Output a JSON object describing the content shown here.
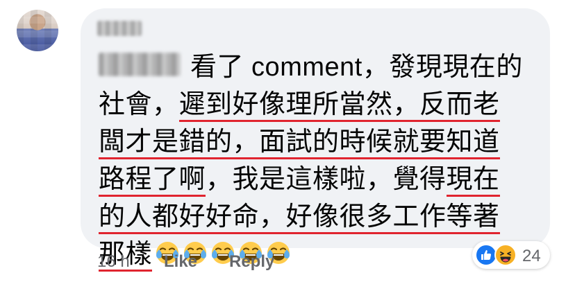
{
  "comment": {
    "lines": [
      "看了 comment，發現現在的",
      "社會，",
      "遲到好像理所當然，反而老",
      "闆才是錯的，面試的時候就要知道",
      "路程了啊",
      "，我是這樣啦，覺得",
      "現在",
      "的人都好好命，好像很多工作等著",
      "那樣"
    ],
    "emoji_name": "laughing-tears-emoji",
    "emoji_count": 5
  },
  "meta": {
    "time": "16 h",
    "like_label": "Like",
    "reply_label": "Reply"
  },
  "reactions": {
    "icons": [
      "like-icon",
      "haha-icon"
    ],
    "count": "24"
  },
  "colors": {
    "bubble": "#f0f2f5",
    "underline": "#e0242f",
    "meta_text": "#65676b",
    "like_blue": "#1877f2",
    "haha_yellow": "#f7b125"
  }
}
